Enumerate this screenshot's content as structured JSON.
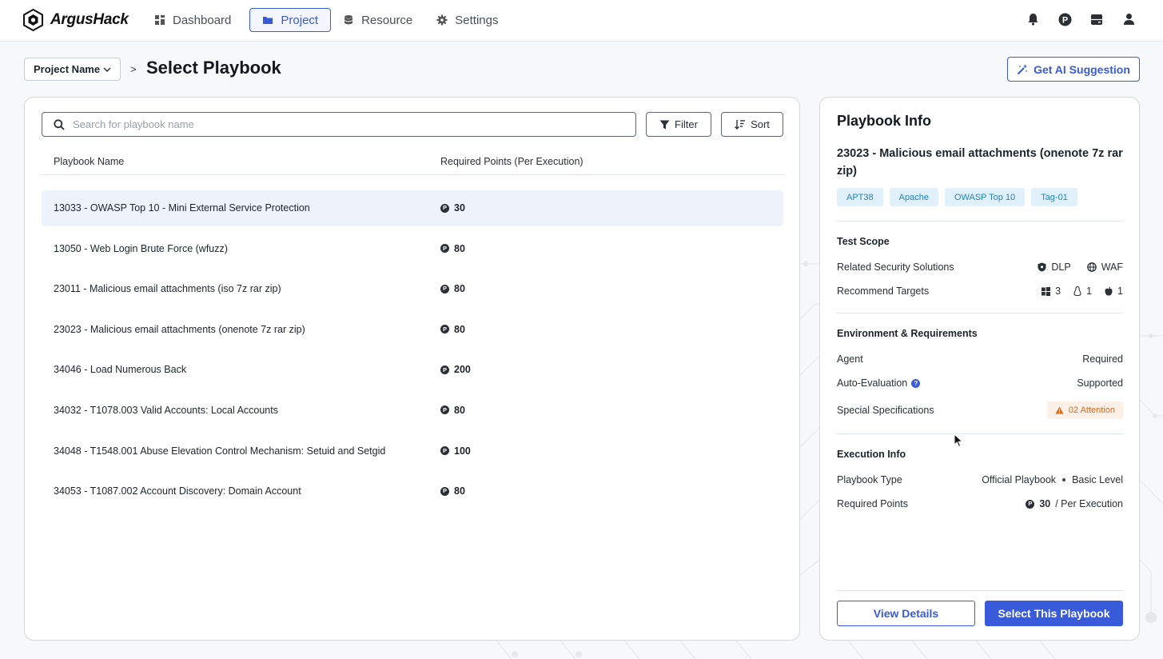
{
  "app": {
    "brand": "ArgusHack"
  },
  "nav": {
    "items": [
      {
        "label": "Dashboard",
        "icon": "grid-icon"
      },
      {
        "label": "Project",
        "icon": "folder-icon",
        "active": true
      },
      {
        "label": "Resource",
        "icon": "database-icon"
      },
      {
        "label": "Settings",
        "icon": "gear-icon"
      }
    ],
    "right_icons": [
      "bell-icon",
      "points-icon",
      "server-icon",
      "user-icon"
    ]
  },
  "header": {
    "project_select": "Project Name",
    "breadcrumb_sep": ">",
    "title": "Select Playbook",
    "ai_button": "Get AI Suggestion"
  },
  "list": {
    "search_placeholder": "Search for playbook name",
    "filter_label": "Filter",
    "sort_label": "Sort",
    "columns": {
      "name": "Playbook Name",
      "points": "Required Points (Per Execution)"
    },
    "rows": [
      {
        "name": "13033 - OWASP Top 10 - Mini External Service Protection",
        "points": "30",
        "selected": true
      },
      {
        "name": "13050 - Web Login Brute Force (wfuzz)",
        "points": "80"
      },
      {
        "name": "23011 - Malicious email attachments (iso 7z rar zip)",
        "points": "80"
      },
      {
        "name": "23023 - Malicious email attachments (onenote 7z rar zip)",
        "points": "80"
      },
      {
        "name": "34046 - Load Numerous Back",
        "points": "200"
      },
      {
        "name": "34032 - T1078.003 Valid Accounts: Local Accounts",
        "points": "80"
      },
      {
        "name": "34048 - T1548.001 Abuse Elevation Control Mechanism: Setuid and Setgid",
        "points": "100"
      },
      {
        "name": "34053 - T1087.002 Account Discovery: Domain Account",
        "points": "80"
      }
    ],
    "coin_symbol": "P"
  },
  "info": {
    "title": "Playbook Info",
    "playbook_name": "23023 - Malicious email attachments (onenote 7z rar zip)",
    "tags": [
      "APT38",
      "Apache",
      "OWASP Top 10",
      "Tag-01"
    ],
    "test_scope": {
      "title": "Test Scope",
      "related_label": "Related Security Solutions",
      "solutions": [
        "DLP",
        "WAF"
      ],
      "targets_label": "Recommend Targets",
      "targets": {
        "windows": "3",
        "linux": "1",
        "mac": "1"
      }
    },
    "env": {
      "title": "Environment & Requirements",
      "agent_label": "Agent",
      "agent_value": "Required",
      "auto_eval_label": "Auto-Evaluation",
      "auto_eval_value": "Supported",
      "special_label": "Special Specifications",
      "special_value": "02 Attention"
    },
    "exec": {
      "title": "Execution Info",
      "type_label": "Playbook Type",
      "type_value_1": "Official Playbook",
      "type_value_2": "Basic Level",
      "points_label": "Required Points",
      "points_value": "30",
      "points_suffix": "/ Per Execution"
    },
    "view_details": "View Details",
    "select_button": "Select This Playbook"
  },
  "colors": {
    "accent": "#3a5bd9",
    "tag_bg": "#e0f1fb",
    "tag_fg": "#1f83c7",
    "warn": "#e0691f"
  }
}
